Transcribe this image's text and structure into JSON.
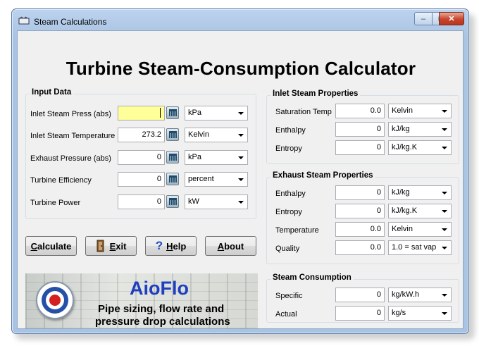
{
  "window": {
    "title": "Steam Calculations",
    "min_glyph": "–",
    "max_glyph": "□",
    "close_glyph": "✕"
  },
  "heading": "Turbine Steam-Consumption Calculator",
  "input_group": {
    "title": "Input Data",
    "rows": [
      {
        "label": "Inlet Steam Press (abs)",
        "value": "",
        "unit": "kPa"
      },
      {
        "label": "Inlet Steam Temperature",
        "value": "273.2",
        "unit": "Kelvin"
      },
      {
        "label": "Exhaust Pressure (abs)",
        "value": "0",
        "unit": "kPa"
      },
      {
        "label": "Turbine Efficiency",
        "value": "0",
        "unit": "percent"
      },
      {
        "label": "Turbine Power",
        "value": "0",
        "unit": "kW"
      }
    ]
  },
  "buttons": {
    "calculate": {
      "hotkey": "C",
      "rest": "alculate"
    },
    "exit": {
      "hotkey": "E",
      "rest": "xit"
    },
    "help": {
      "hotkey": "H",
      "rest": "elp"
    },
    "about": {
      "hotkey": "A",
      "rest": "bout"
    }
  },
  "banner": {
    "brand": "AioFlo",
    "line1": "Pipe sizing, flow rate and",
    "line2": "pressure drop calculations"
  },
  "inlet_group": {
    "title": "Inlet Steam Properties",
    "rows": [
      {
        "label": "Saturation Temp",
        "value": "0.0",
        "unit": "Kelvin"
      },
      {
        "label": "Enthalpy",
        "value": "0",
        "unit": "kJ/kg"
      },
      {
        "label": "Entropy",
        "value": "0",
        "unit": "kJ/kg.K"
      }
    ]
  },
  "exhaust_group": {
    "title": "Exhaust Steam Properties",
    "rows": [
      {
        "label": "Enthalpy",
        "value": "0",
        "unit": "kJ/kg"
      },
      {
        "label": "Entropy",
        "value": "0",
        "unit": "kJ/kg.K"
      },
      {
        "label": "Temperature",
        "value": "0.0",
        "unit": "Kelvin"
      },
      {
        "label": "Quality",
        "value": "0.0",
        "unit": "1.0 = sat vap"
      }
    ]
  },
  "consumption_group": {
    "title": "Steam Consumption",
    "rows": [
      {
        "label": "Specific",
        "value": "0",
        "unit": "kg/kW.h"
      },
      {
        "label": "Actual",
        "value": "0",
        "unit": "kg/s"
      }
    ]
  },
  "colors": {
    "highlight_field": "#ffff99",
    "brand_blue": "#1f3fbf",
    "close_red": "#c8442c"
  }
}
